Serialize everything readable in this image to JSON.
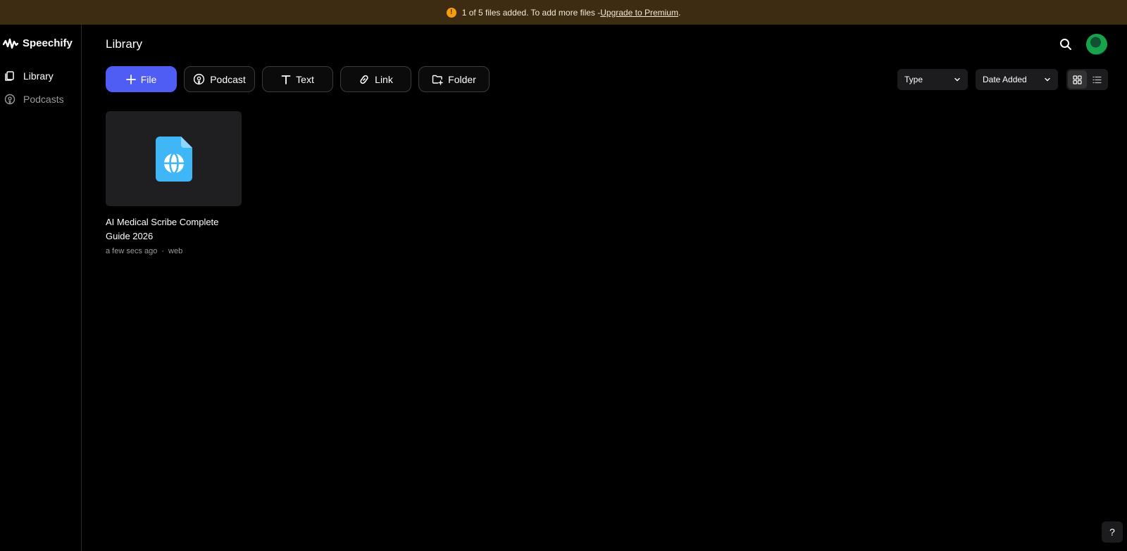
{
  "banner": {
    "message": "1 of 5 files added. To add more files - ",
    "link": "Upgrade to Premium",
    "suffix": "."
  },
  "brand": {
    "name": "Speechify"
  },
  "sidebar": {
    "items": [
      {
        "label": "Library",
        "active": true
      },
      {
        "label": "Podcasts",
        "active": false
      }
    ]
  },
  "header": {
    "title": "Library"
  },
  "actions": {
    "file": "File",
    "podcast": "Podcast",
    "text": "Text",
    "link": "Link",
    "folder": "Folder"
  },
  "filters": {
    "type": "Type",
    "sort": "Date Added"
  },
  "library_items": [
    {
      "title": "AI Medical Scribe Complete Guide 2026",
      "time": "a few secs ago",
      "source": "web"
    }
  ],
  "help": {
    "label": "?"
  },
  "colors": {
    "accent": "#4f5df5",
    "banner_bg": "#3d2b12",
    "warning": "#f59e0b",
    "file_icon": "#3fb6f5"
  }
}
